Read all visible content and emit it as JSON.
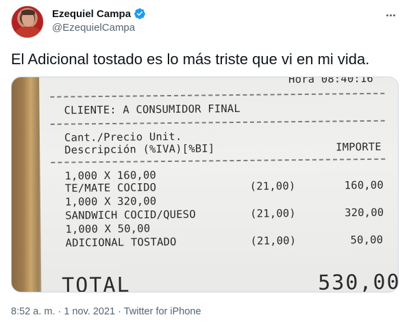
{
  "author": {
    "display_name": "Ezequiel Campa",
    "handle": "@EzequielCampa",
    "verified": true
  },
  "tweet": {
    "text": "El Adicional tostado es lo más triste que vi en mi vida."
  },
  "receipt": {
    "hora": "Hora 08:40:16",
    "cliente": "CLIENTE: A CONSUMIDOR FINAL",
    "header_line1": "Cant./Precio Unit.",
    "header_line2": "Descripción (%IVA)[%BI]",
    "header_importe": "IMPORTE",
    "items": [
      {
        "qty": "1,000 X 160,00",
        "desc": "TE/MATE COCIDO",
        "iva": "(21,00)",
        "importe": "160,00"
      },
      {
        "qty": "1,000 X 320,00",
        "desc": "SANDWICH COCID/QUESO",
        "iva": "(21,00)",
        "importe": "320,00"
      },
      {
        "qty": "1,000 X 50,00",
        "desc": "ADICIONAL TOSTADO",
        "iva": "(21,00)",
        "importe": "50,00"
      }
    ],
    "total_label": "TOTAL",
    "total_value": "530,00"
  },
  "meta": {
    "time": "8:52 a. m.",
    "sep1": " · ",
    "date": "1 nov. 2021",
    "sep2": " · ",
    "source": "Twitter for iPhone"
  },
  "colors": {
    "verified": "#1d9bf0",
    "muted": "#536471",
    "text": "#0f1419"
  },
  "icons": {
    "verified": "verified-badge-icon",
    "more": "more-horizontal-icon"
  }
}
